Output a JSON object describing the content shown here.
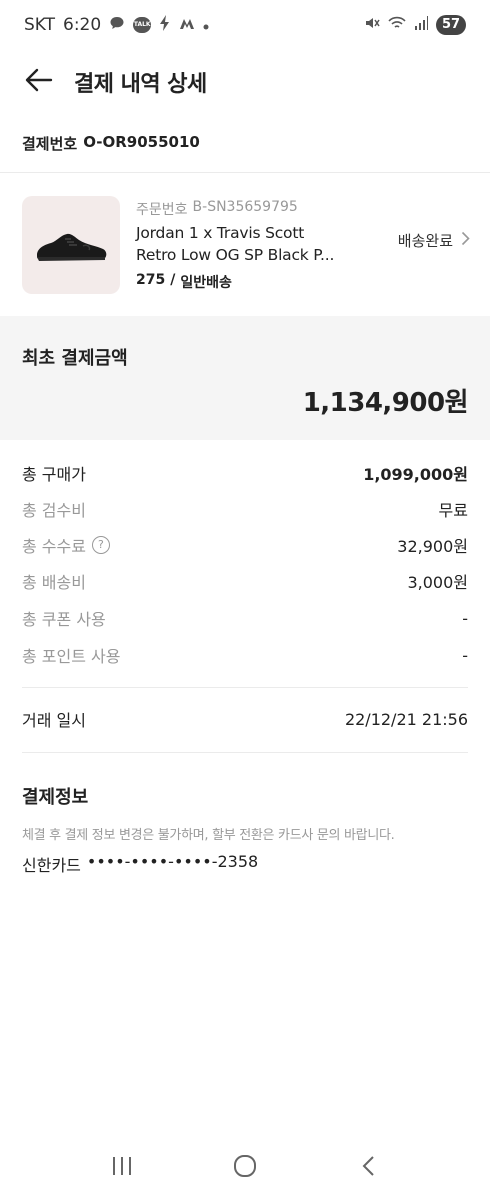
{
  "status_bar": {
    "carrier": "SKT",
    "time": "6:20",
    "talk_badge": "TALK",
    "battery": "57"
  },
  "header": {
    "title": "결제 내역 상세"
  },
  "payment": {
    "number_label": "결제번호",
    "number_value": "O-OR9055010"
  },
  "product": {
    "order_label": "주문번호",
    "order_value": "B-SN35659795",
    "name_line1": "Jordan 1 x Travis Scott",
    "name_line2": "Retro Low OG SP Black P...",
    "size": "275",
    "separator": "/",
    "shipping_type": "일반배송",
    "status": "배송완료"
  },
  "initial_payment": {
    "label": "최초 결제금액",
    "amount": "1,134,900원"
  },
  "costs": [
    {
      "label": "총 구매가",
      "value": "1,099,000원"
    },
    {
      "label": "총 검수비",
      "value": "무료"
    },
    {
      "label": "총 수수료",
      "value": "32,900원"
    },
    {
      "label": "총 배송비",
      "value": "3,000원"
    },
    {
      "label": "총 쿠폰 사용",
      "value": "-"
    },
    {
      "label": "총 포인트 사용",
      "value": "-"
    }
  ],
  "transaction": {
    "label": "거래 일시",
    "value": "22/12/21 21:56"
  },
  "payment_info": {
    "title": "결제정보",
    "notice": "체결 후 결제 정보 변경은 불가하며, 할부 전환은 카드사 문의 바랍니다.",
    "card_name": "신한카드",
    "card_number": "••••-••••-••••-2358"
  },
  "colors": {
    "primary_text": "#222222",
    "secondary_text": "#999999",
    "panel_bg": "#f5f5f5",
    "thumb_bg": "#f3ebea"
  },
  "icons": {
    "back": "arrow-left-icon",
    "status_chevron": "chevron-right-icon",
    "help": "question-circle-icon"
  }
}
